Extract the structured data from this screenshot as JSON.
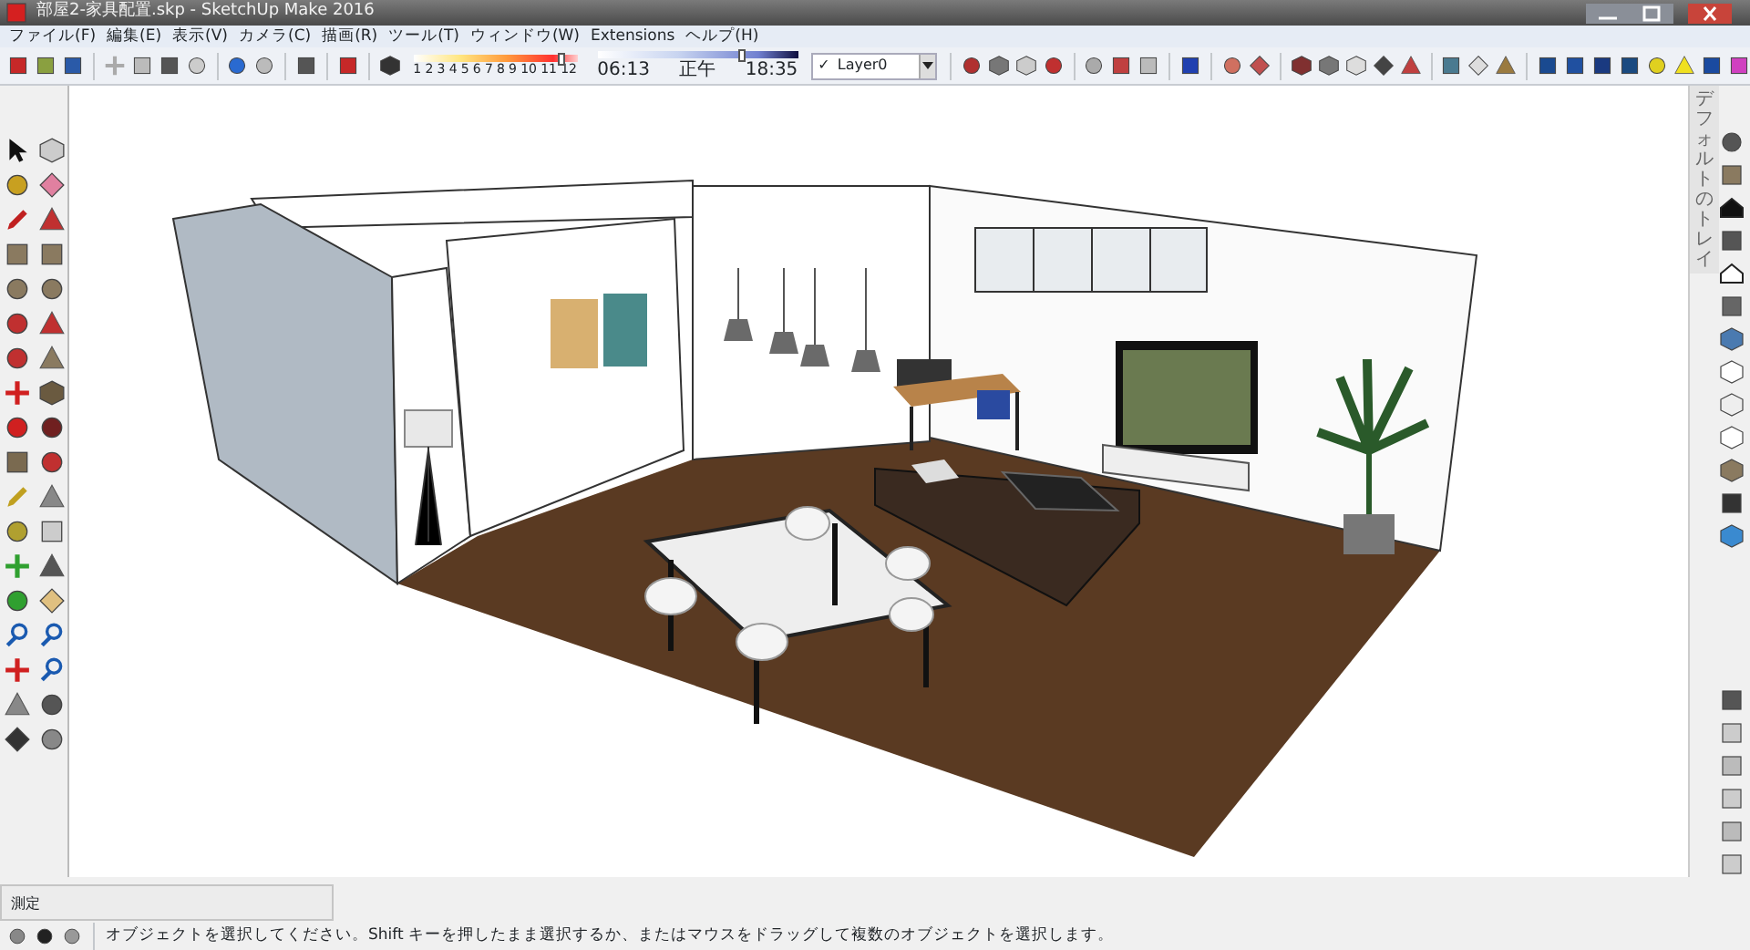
{
  "window": {
    "title": "部屋2-家具配置.skp - SketchUp Make 2016"
  },
  "menu": [
    "ファイル(F)",
    "編集(E)",
    "表示(V)",
    "カメラ(C)",
    "描画(R)",
    "ツール(T)",
    "ウィンドウ(W)",
    "Extensions",
    "ヘルプ(H)"
  ],
  "toolbar": {
    "month_slider": {
      "level": 0.9
    },
    "time_slider": {
      "level": 0.72
    },
    "month_scale": [
      "1",
      "2",
      "3",
      "4",
      "5",
      "6",
      "7",
      "8",
      "9",
      "10",
      "11",
      "12"
    ],
    "time_scale": [
      "06:13",
      "正午",
      "18:35"
    ],
    "layer": {
      "check": "✓",
      "name": "Layer0"
    }
  },
  "tray": {
    "tab": "デフォルトのトレイ"
  },
  "measurements": {
    "label": "測定"
  },
  "status_bar": {
    "text": "オブジェクトを選択してください。Shift キーを押したまま選択するか、またはマウスをドラッグして複数のオブジェクトを選択します。"
  }
}
